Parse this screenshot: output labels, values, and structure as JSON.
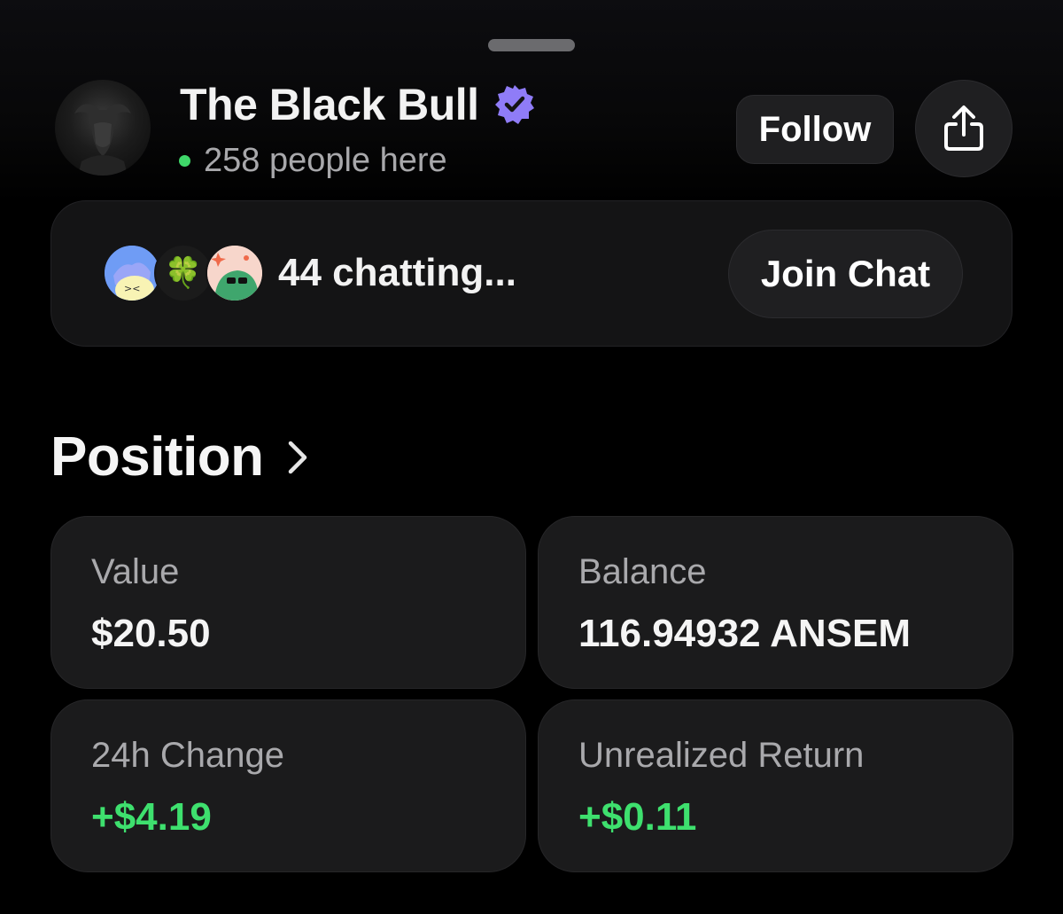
{
  "header": {
    "title": "The Black Bull",
    "presence_text": "258 people here",
    "follow_label": "Follow"
  },
  "chat": {
    "status_text": "44 chatting...",
    "join_label": "Join Chat",
    "participant_emoji": "🍀"
  },
  "position": {
    "title": "Position",
    "stats": [
      {
        "label": "Value",
        "value": "$20.50"
      },
      {
        "label": "Balance",
        "value": "116.94932 ANSEM"
      },
      {
        "label": "24h Change",
        "value": "+$4.19"
      },
      {
        "label": "Unrealized Return",
        "value": "+$0.11"
      }
    ]
  },
  "colors": {
    "background": "#000000",
    "card": "#1b1b1c",
    "verified": "#8f7cf7",
    "positive": "#3ee06e",
    "presence": "#3fd86a"
  },
  "icons": {
    "verified": "verified-badge-icon",
    "share": "share-icon",
    "chevron": "chevron-right-icon"
  }
}
